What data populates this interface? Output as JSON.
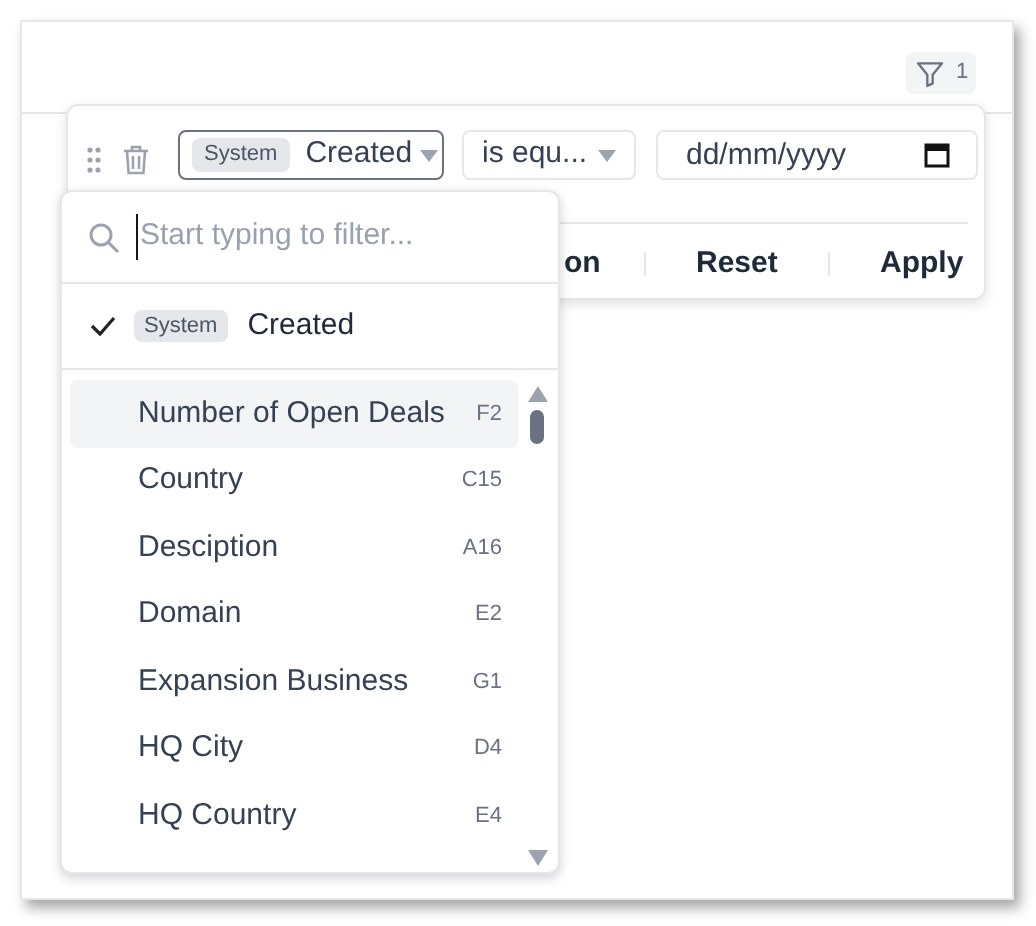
{
  "toolbar": {
    "filter_count": "1"
  },
  "filter_row": {
    "field": {
      "badge": "System",
      "label": "Created"
    },
    "operator": "is equ...",
    "date": {
      "placeholder": "dd/mm/yyyy"
    }
  },
  "footer": [
    "on",
    "Reset",
    "Apply"
  ],
  "dropdown": {
    "search": {
      "placeholder": "Start typing to filter..."
    },
    "selected_field": {
      "badge": "System",
      "label": "Created",
      "checked": true
    },
    "items": [
      {
        "label": "Number of Open Deals",
        "code": "F2",
        "selected": true
      },
      {
        "label": "Country",
        "code": "C15",
        "selected": false
      },
      {
        "label": "Desciption",
        "code": "A16",
        "selected": false
      },
      {
        "label": "Domain",
        "code": "E2",
        "selected": false
      },
      {
        "label": "Expansion Business",
        "code": "G1",
        "selected": false
      },
      {
        "label": "HQ City",
        "code": "D4",
        "selected": false
      },
      {
        "label": "HQ Country",
        "code": "E4",
        "selected": false
      }
    ]
  }
}
